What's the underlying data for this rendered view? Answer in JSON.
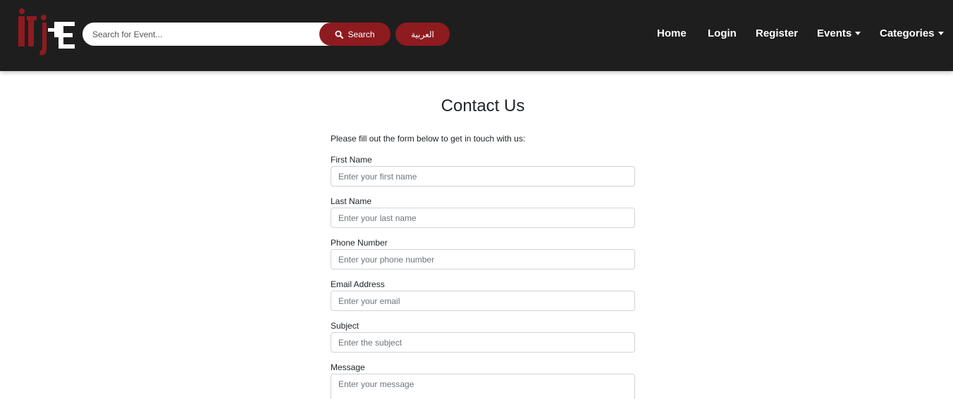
{
  "navbar": {
    "logo_text": "iTi E",
    "search": {
      "placeholder": "Search for Event...",
      "value": "",
      "button_label": "Search"
    },
    "language_button": "العربية",
    "links": [
      {
        "label": "Home",
        "dropdown": false
      },
      {
        "label": "Login",
        "dropdown": false
      },
      {
        "label": "Register",
        "dropdown": false
      },
      {
        "label": "Events",
        "dropdown": true
      },
      {
        "label": "Categories",
        "dropdown": true
      }
    ],
    "colors": {
      "background": "#1e1e1e",
      "accent": "#8e1b1f"
    }
  },
  "page": {
    "title": "Contact Us",
    "intro": "Please fill out the form below to get in touch with us:"
  },
  "form": {
    "fields": [
      {
        "label": "First Name",
        "placeholder": "Enter your first name",
        "value": ""
      },
      {
        "label": "Last Name",
        "placeholder": "Enter your last name",
        "value": ""
      },
      {
        "label": "Phone Number",
        "placeholder": "Enter your phone number",
        "value": ""
      },
      {
        "label": "Email Address",
        "placeholder": "Enter your email",
        "value": ""
      },
      {
        "label": "Subject",
        "placeholder": "Enter the subject",
        "value": ""
      },
      {
        "label": "Message",
        "placeholder": "Enter your message",
        "value": ""
      }
    ]
  }
}
